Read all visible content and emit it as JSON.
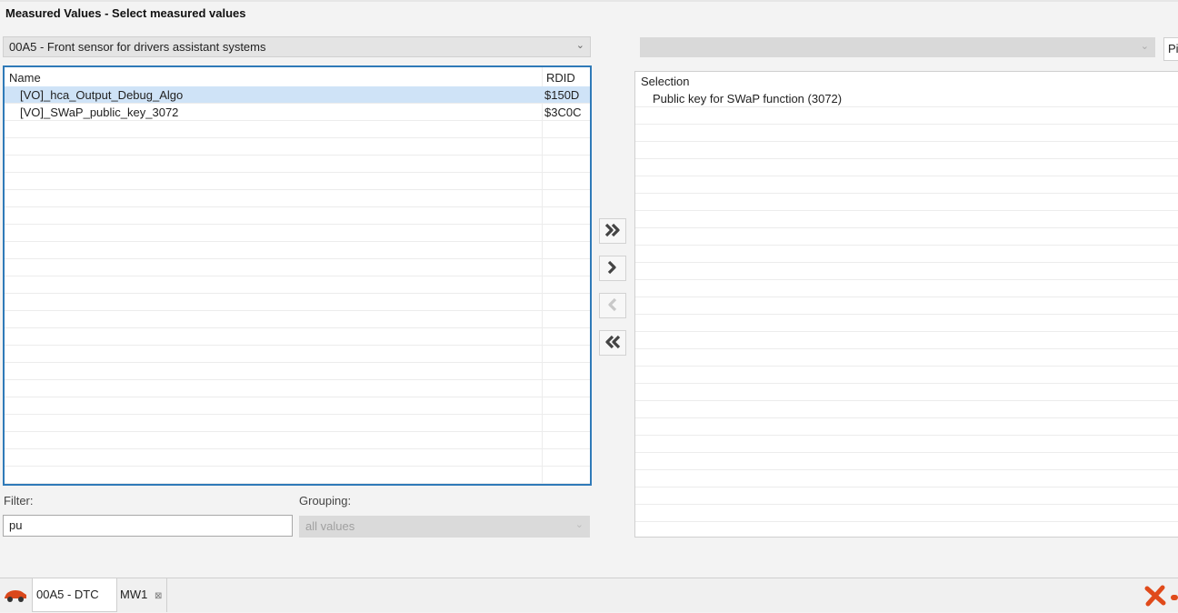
{
  "window": {
    "title": "Measured Values - Select measured values"
  },
  "control_unit_select": {
    "selected": "00A5 - Front sensor for drivers assistant systems"
  },
  "right_select": {
    "selected": "",
    "side_button_label": "Pi"
  },
  "available_list": {
    "columns": [
      "Name",
      "RDID"
    ],
    "rows": [
      {
        "name": "[VO]_hca_Output_Debug_Algo",
        "rdid": "$150D",
        "selected": true
      },
      {
        "name": "[VO]_SWaP_public_key_3072",
        "rdid": "$3C0C",
        "selected": false
      }
    ]
  },
  "selection_list": {
    "header": "Selection",
    "items": [
      "Public key for SWaP function (3072)"
    ]
  },
  "transfer_buttons": [
    {
      "icon": "double-chevron-right-icon",
      "enabled": true
    },
    {
      "icon": "chevron-right-icon",
      "enabled": true
    },
    {
      "icon": "chevron-left-icon",
      "enabled": false
    },
    {
      "icon": "double-chevron-left-icon",
      "enabled": true
    }
  ],
  "filter": {
    "label": "Filter:",
    "value": "pu"
  },
  "grouping": {
    "label": "Grouping:",
    "value": "all values"
  },
  "taskbar": {
    "tabs": [
      {
        "label": "00A5 - DTC"
      },
      {
        "label": "MW1",
        "close_glyph": "⊠"
      }
    ]
  },
  "colors": {
    "accent_border": "#2f7ab8",
    "row_selected": "#cfe3f7",
    "close_red": "#e04a1a"
  }
}
